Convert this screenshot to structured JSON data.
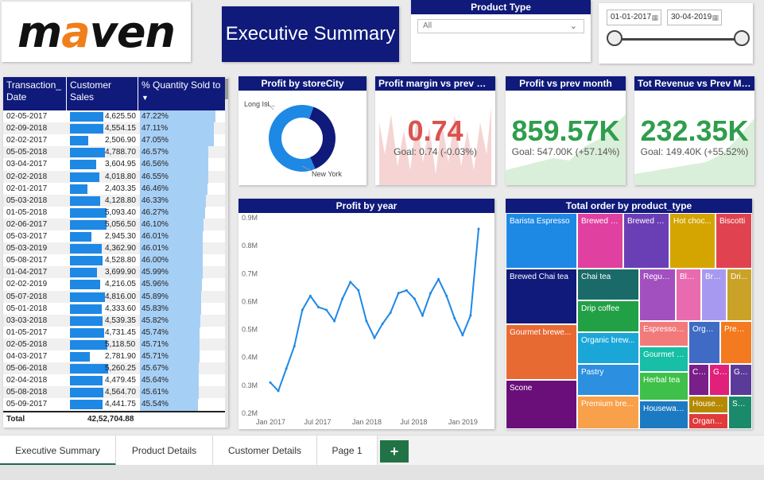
{
  "logo": {
    "text_pre": "m",
    "text_a": "a",
    "text_post": "ven"
  },
  "header": {
    "title": "Executive Summary"
  },
  "product_type": {
    "label": "Product Type",
    "value": "All"
  },
  "date_range": {
    "start": "01-01-2017",
    "end": "30-04-2019"
  },
  "table": {
    "columns": [
      "Transaction_ Date",
      "Customer Sales",
      "% Quantity Sold to"
    ],
    "rows": [
      {
        "date": "02-05-2017",
        "sales": "4,625.50",
        "pct": "47.22%",
        "sales_val": 4625.5,
        "pct_val": 47.22
      },
      {
        "date": "02-09-2018",
        "sales": "4,554.15",
        "pct": "47.11%",
        "sales_val": 4554.15,
        "pct_val": 47.11
      },
      {
        "date": "02-02-2017",
        "sales": "2,506.90",
        "pct": "47.05%",
        "sales_val": 2506.9,
        "pct_val": 47.05
      },
      {
        "date": "05-05-2018",
        "sales": "4,788.70",
        "pct": "46.57%",
        "sales_val": 4788.7,
        "pct_val": 46.57
      },
      {
        "date": "03-04-2017",
        "sales": "3,604.95",
        "pct": "46.56%",
        "sales_val": 3604.95,
        "pct_val": 46.56
      },
      {
        "date": "02-02-2018",
        "sales": "4,018.80",
        "pct": "46.55%",
        "sales_val": 4018.8,
        "pct_val": 46.55
      },
      {
        "date": "02-01-2017",
        "sales": "2,403.35",
        "pct": "46.46%",
        "sales_val": 2403.35,
        "pct_val": 46.46
      },
      {
        "date": "05-03-2018",
        "sales": "4,128.80",
        "pct": "46.33%",
        "sales_val": 4128.8,
        "pct_val": 46.33
      },
      {
        "date": "01-05-2018",
        "sales": "5,093.40",
        "pct": "46.27%",
        "sales_val": 5093.4,
        "pct_val": 46.27
      },
      {
        "date": "02-06-2017",
        "sales": "5,056.50",
        "pct": "46.10%",
        "sales_val": 5056.5,
        "pct_val": 46.1
      },
      {
        "date": "05-03-2017",
        "sales": "2,945.30",
        "pct": "46.01%",
        "sales_val": 2945.3,
        "pct_val": 46.01
      },
      {
        "date": "05-03-2019",
        "sales": "4,362.90",
        "pct": "46.01%",
        "sales_val": 4362.9,
        "pct_val": 46.01
      },
      {
        "date": "05-08-2017",
        "sales": "4,528.80",
        "pct": "46.00%",
        "sales_val": 4528.8,
        "pct_val": 46.0
      },
      {
        "date": "01-04-2017",
        "sales": "3,699.90",
        "pct": "45.99%",
        "sales_val": 3699.9,
        "pct_val": 45.99
      },
      {
        "date": "02-02-2019",
        "sales": "4,216.05",
        "pct": "45.96%",
        "sales_val": 4216.05,
        "pct_val": 45.96
      },
      {
        "date": "05-07-2018",
        "sales": "4,816.00",
        "pct": "45.89%",
        "sales_val": 4816.0,
        "pct_val": 45.89
      },
      {
        "date": "05-01-2018",
        "sales": "4,333.60",
        "pct": "45.83%",
        "sales_val": 4333.6,
        "pct_val": 45.83
      },
      {
        "date": "03-03-2018",
        "sales": "4,539.35",
        "pct": "45.82%",
        "sales_val": 4539.35,
        "pct_val": 45.82
      },
      {
        "date": "01-05-2017",
        "sales": "4,731.45",
        "pct": "45.74%",
        "sales_val": 4731.45,
        "pct_val": 45.74
      },
      {
        "date": "02-05-2018",
        "sales": "5,118.50",
        "pct": "45.71%",
        "sales_val": 5118.5,
        "pct_val": 45.71
      },
      {
        "date": "04-03-2017",
        "sales": "2,781.90",
        "pct": "45.71%",
        "sales_val": 2781.9,
        "pct_val": 45.71
      },
      {
        "date": "05-06-2018",
        "sales": "5,260.25",
        "pct": "45.67%",
        "sales_val": 5260.25,
        "pct_val": 45.67
      },
      {
        "date": "02-04-2018",
        "sales": "4,479.45",
        "pct": "45.64%",
        "sales_val": 4479.45,
        "pct_val": 45.64
      },
      {
        "date": "05-08-2018",
        "sales": "4,564.70",
        "pct": "45.61%",
        "sales_val": 4564.7,
        "pct_val": 45.61
      },
      {
        "date": "05-09-2017",
        "sales": "4,441.75",
        "pct": "45.54%",
        "sales_val": 4441.75,
        "pct_val": 45.54
      }
    ],
    "total_label": "Total",
    "total_value": "42,52,704.88"
  },
  "donut": {
    "title": "Profit by storeCity",
    "labels": [
      "Long Isl...",
      "New York"
    ],
    "slices": [
      {
        "name": "Long Isl...",
        "value": 0.38,
        "color": "#0f1a7a"
      },
      {
        "name": "New York",
        "value": 0.62,
        "color": "#1e88e5"
      }
    ]
  },
  "kpi_margin": {
    "title": "Profit margin vs prev m...",
    "value": "0.74",
    "goal": "Goal: 0.74 (-0.03%)",
    "color": "#d9534f"
  },
  "kpi_profit": {
    "title": "Profit vs prev month",
    "value": "859.57K",
    "goal": "Goal: 547.00K (+57.14%)",
    "color": "#2e9e4c"
  },
  "kpi_revenue": {
    "title": "Tot Revenue vs Prev Mo...",
    "value": "232.35K",
    "goal": "Goal: 149.40K (+55.52%)",
    "color": "#2e9e4c"
  },
  "chart_data": {
    "type": "line",
    "title": "Profit by year",
    "x_ticks": [
      "Jan 2017",
      "Jul 2017",
      "Jan 2018",
      "Jul 2018",
      "Jan 2019"
    ],
    "y_ticks": [
      "0.9M",
      "0.8M",
      "0.7M",
      "0.6M",
      "0.5M",
      "0.4M",
      "0.3M",
      "0.2M"
    ],
    "ylim": [
      0.2,
      0.9
    ],
    "y_unit": "M",
    "x": [
      0,
      1,
      2,
      3,
      4,
      5,
      6,
      7,
      8,
      9,
      10,
      11,
      12,
      13,
      14,
      15,
      16,
      17,
      18,
      19,
      20,
      21,
      22,
      23,
      24,
      25,
      26,
      27
    ],
    "values": [
      0.31,
      0.28,
      0.36,
      0.44,
      0.57,
      0.62,
      0.58,
      0.57,
      0.53,
      0.61,
      0.67,
      0.64,
      0.53,
      0.47,
      0.52,
      0.56,
      0.63,
      0.64,
      0.61,
      0.55,
      0.63,
      0.68,
      0.62,
      0.54,
      0.48,
      0.55,
      0.86
    ],
    "color": "#1e88e5",
    "grid": false
  },
  "treemap": {
    "title": "Total order by product_type",
    "items": [
      {
        "label": "Barista Espresso",
        "color": "#1e88e5"
      },
      {
        "label": "Brewed B...",
        "color": "#e040a0"
      },
      {
        "label": "Brewed h...",
        "color": "#6a3fb5"
      },
      {
        "label": "Hot choc...",
        "color": "#d4a500"
      },
      {
        "label": "Biscotti",
        "color": "#e0434f"
      },
      {
        "label": "Brewed Chai tea",
        "color": "#0f1a7a"
      },
      {
        "label": "Chai tea",
        "color": "#1b6a6a"
      },
      {
        "label": "Regula...",
        "color": "#a24fc0"
      },
      {
        "label": "Bla...",
        "color": "#e86bb0"
      },
      {
        "label": "Bre...",
        "color": "#a899f0"
      },
      {
        "label": "Dri...",
        "color": "#c9a227"
      },
      {
        "label": "Drip coffee",
        "color": "#22a046"
      },
      {
        "label": "Gourmet brewe...",
        "color": "#e86a33"
      },
      {
        "label": "Organic brew...",
        "color": "#1aa7d8"
      },
      {
        "label": "Espresso B...",
        "color": "#f27a7a"
      },
      {
        "label": "Orga...",
        "color": "#3f6bc4"
      },
      {
        "label": "Prem...",
        "color": "#f47a1f"
      },
      {
        "label": "Gourmet B...",
        "color": "#16bfa5"
      },
      {
        "label": "Pastry",
        "color": "#2d8fe0"
      },
      {
        "label": "Cl...",
        "color": "#7a1e8a"
      },
      {
        "label": "Gr...",
        "color": "#e0207a"
      },
      {
        "label": "Gr...",
        "color": "#5b3b9a"
      },
      {
        "label": "Herbal tea",
        "color": "#3fc04a"
      },
      {
        "label": "Scone",
        "color": "#6a0f7a"
      },
      {
        "label": "Premium bre...",
        "color": "#f9a04a"
      },
      {
        "label": "Housewares",
        "color": "#1c7ac2"
      },
      {
        "label": "House b...",
        "color": "#b58a00"
      },
      {
        "label": "Su...",
        "color": "#1b8a6a"
      },
      {
        "label": "Organic...",
        "color": "#e03a3a"
      }
    ]
  },
  "tabs": [
    "Executive Summary",
    "Product Details",
    "Customer Details",
    "Page 1"
  ],
  "add_tab": "+"
}
